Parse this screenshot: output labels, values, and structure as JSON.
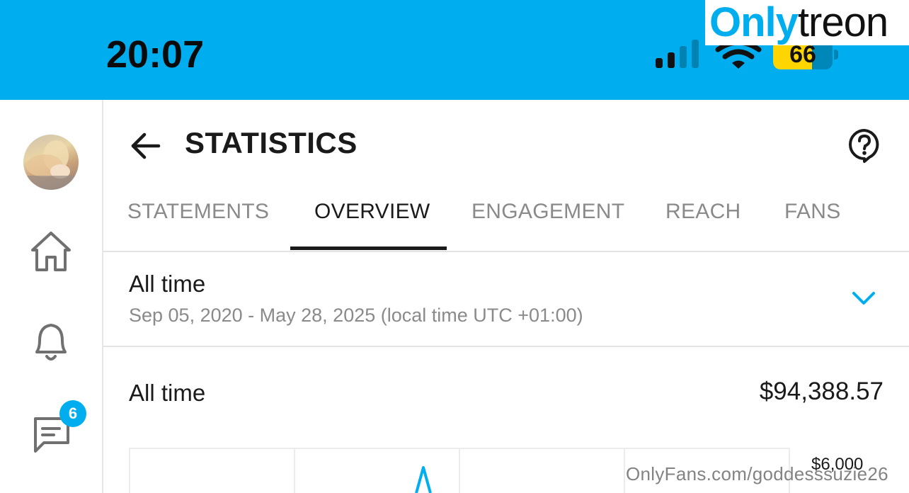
{
  "watermark": {
    "logo_accent": "Only",
    "logo_rest": "treon",
    "url": "OnlyFans.com/goddesssuzie26"
  },
  "status_bar": {
    "time": "20:07",
    "battery_level": 66,
    "battery_text": "66",
    "background_color": "#00aeef"
  },
  "sidebar": {
    "avatar_icon": "profile-photo",
    "items": [
      {
        "icon": "home-icon"
      },
      {
        "icon": "bell-icon"
      },
      {
        "icon": "messages-icon",
        "badge": "6"
      }
    ]
  },
  "header": {
    "back_icon": "arrow-left-icon",
    "title": "STATISTICS",
    "help_icon": "question-bubble-icon"
  },
  "tabs": [
    {
      "label": "STATEMENTS",
      "active": false
    },
    {
      "label": "OVERVIEW",
      "active": true
    },
    {
      "label": "ENGAGEMENT",
      "active": false
    },
    {
      "label": "REACH",
      "active": false
    },
    {
      "label": "FANS",
      "active": false
    }
  ],
  "period": {
    "title": "All time",
    "range": "Sep 05, 2020 - May 28, 2025 (local time UTC +01:00)",
    "chevron_icon": "chevron-down-icon",
    "accent_color": "#00aeef"
  },
  "total": {
    "label": "All time",
    "value": "$94,388.57"
  },
  "chart": {
    "y_tick_top": "$6,000",
    "line_color": "#00aeef"
  }
}
